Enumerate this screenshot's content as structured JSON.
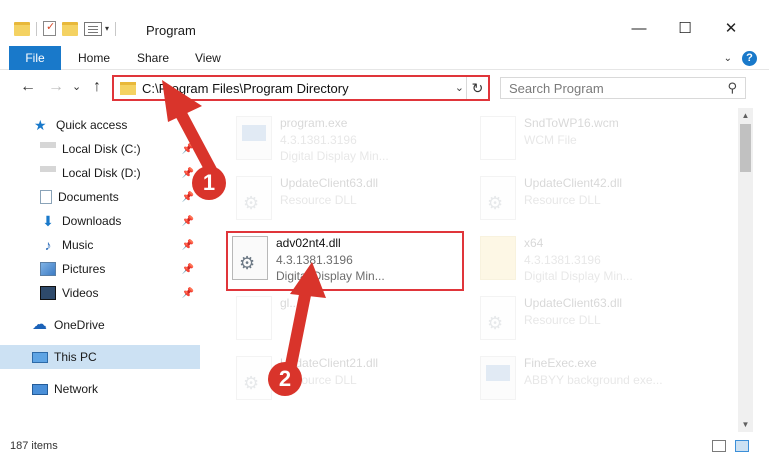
{
  "window": {
    "title": "Program",
    "minimize_glyph": "—",
    "maximize_glyph": "☐",
    "close_glyph": "✕"
  },
  "ribbon": {
    "tabs": [
      "File",
      "Home",
      "Share",
      "View"
    ],
    "help_glyph": "?"
  },
  "navigation": {
    "address": "C:\\Program Files\\Program Directory",
    "search_placeholder": "Search Program",
    "back_glyph": "←",
    "forward_glyph": "→",
    "recent_glyph": "⌄",
    "up_glyph": "↑",
    "refresh_glyph": "↻",
    "dropdown_glyph": "⌄",
    "search_glyph": "⚲"
  },
  "sidebar": {
    "items": [
      {
        "label": "Quick access",
        "icon": "star-icon"
      },
      {
        "label": "Local Disk (C:)",
        "icon": "drive-icon"
      },
      {
        "label": "Local Disk (D:)",
        "icon": "drive-icon"
      },
      {
        "label": "Documents",
        "icon": "documents-icon"
      },
      {
        "label": "Downloads",
        "icon": "downloads-icon"
      },
      {
        "label": "Music",
        "icon": "music-icon"
      },
      {
        "label": "Pictures",
        "icon": "pictures-icon"
      },
      {
        "label": "Videos",
        "icon": "videos-icon"
      },
      {
        "label": "OneDrive",
        "icon": "cloud-icon"
      },
      {
        "label": "This PC",
        "icon": "computer-icon"
      },
      {
        "label": "Network",
        "icon": "network-icon"
      }
    ],
    "pin_glyph": "📌"
  },
  "files": [
    {
      "name": "program.exe",
      "line2": "4.3.1381.3196",
      "line3": "Digital Display Min...",
      "type": "exe",
      "faded": true
    },
    {
      "name": "SndToWP16.wcm",
      "line2": "WCM File",
      "line3": "",
      "type": "blank",
      "faded": true
    },
    {
      "name": "UpdateClient63.dll",
      "line2": "Resource DLL",
      "line3": "",
      "type": "dll",
      "faded": true
    },
    {
      "name": "UpdateClient42.dll",
      "line2": "Resource DLL",
      "line3": "",
      "type": "dll",
      "faded": true
    },
    {
      "name": "adv02nt4.dll",
      "line2": "4.3.1381.3196",
      "line3": "Digital Display Min...",
      "type": "dll",
      "faded": false
    },
    {
      "name": "x64",
      "line2": "4.3.1381.3196",
      "line3": "Digital Display Min...",
      "type": "folder",
      "faded": true
    },
    {
      "name": "gl...",
      "line2": "",
      "line3": "",
      "type": "blank",
      "faded": true
    },
    {
      "name": "UpdateClient63.dll",
      "line2": "Resource DLL",
      "line3": "",
      "type": "dll",
      "faded": true
    },
    {
      "name": "UpdateClient21.dll",
      "line2": "Resource DLL",
      "line3": "",
      "type": "dll",
      "faded": true
    },
    {
      "name": "FineExec.exe",
      "line2": "ABBYY background exe...",
      "line3": "",
      "type": "exe",
      "faded": true
    }
  ],
  "status": {
    "item_count": "187 items"
  },
  "annotations": {
    "callout_1": "1",
    "callout_2": "2",
    "color": "#d9342b"
  },
  "colors": {
    "accent": "#1979ca",
    "highlight_border": "#e0353a",
    "selected_bg": "#cce1f3"
  }
}
